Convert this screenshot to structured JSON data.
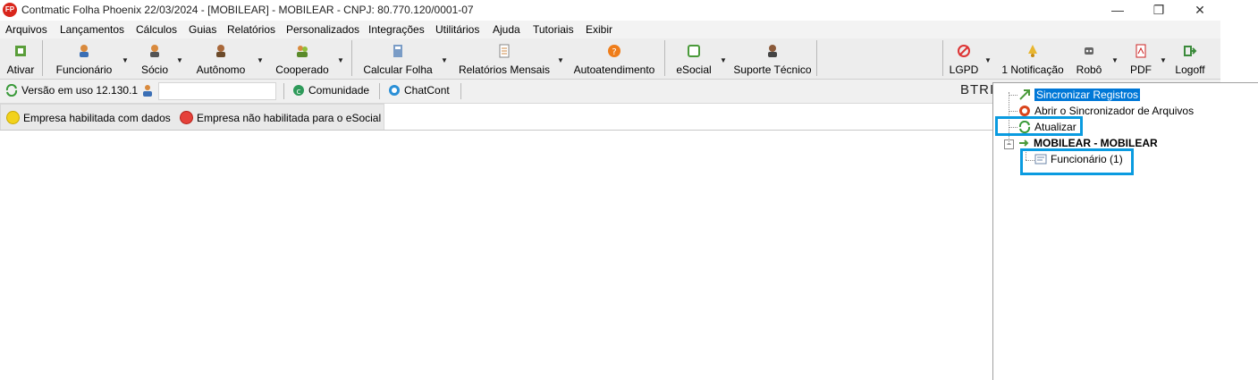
{
  "window": {
    "title": "Contmatic Folha Phoenix 22/03/2024 - [MOBILEAR] - MOBILEAR - CNPJ: 80.770.120/0001-07",
    "app_icon_text": "FP",
    "controls": {
      "minimize": "—",
      "restore": "❐",
      "close": "✕"
    }
  },
  "menu": [
    "Arquivos",
    "Lançamentos",
    "Cálculos",
    "Guias",
    "Relatórios",
    "Personalizados",
    "Integrações",
    "Utilitários",
    "Ajuda",
    "Tutoriais",
    "Exibir"
  ],
  "toolbar": {
    "ativar": "Ativar",
    "funcionario": "Funcionário",
    "socio": "Sócio",
    "autonomo": "Autônomo",
    "cooperado": "Cooperado",
    "calcular_folha": "Calcular Folha",
    "relatorios_mensais": "Relatórios Mensais",
    "autoatendimento": "Autoatendimento",
    "esocial": "eSocial",
    "suporte_tecnico": "Suporte Técnico",
    "lgpd": "LGPD",
    "notificacao": "1 Notificação",
    "robo": "Robô",
    "pdf": "PDF",
    "logoff": "Logoff",
    "dropdown_glyph": "▼"
  },
  "status_row": {
    "versao": "Versão em uso 12.130.1",
    "comunidade": "Comunidade",
    "chatcont": "ChatCont",
    "btrieve": "BTRIE"
  },
  "legend": {
    "habilitada": "Empresa habilitada com dados",
    "nao_habilitada": "Empresa não habilitada para o eSocial",
    "color_habilitada": "#f2d21b",
    "color_nao_habilitada": "#e5413a"
  },
  "tree": {
    "sincronizar": "Sincronizar Registros",
    "abrir": "Abrir o Sincronizador de Arquivos",
    "atualizar": "Atualizar",
    "empresa": "MOBILEAR - MOBILEAR",
    "funcionario": "Funcionário (1)",
    "collapse_glyph": "−"
  },
  "colors": {
    "highlight": "#0a9be0",
    "selection": "#0078d7"
  }
}
